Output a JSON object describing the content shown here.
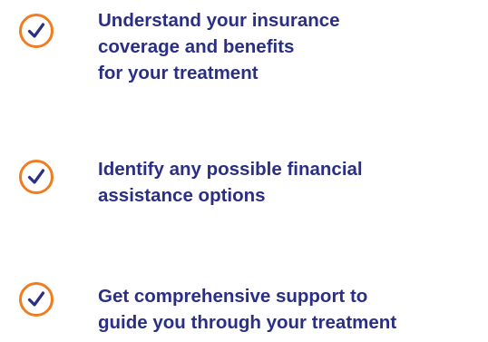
{
  "colors": {
    "accent": "#f07d1f",
    "text": "#2a2f85",
    "check": "#2a2f85"
  },
  "items": [
    {
      "icon": "check-circle-icon",
      "lines": [
        "Understand your insurance",
        "coverage and benefits",
        "for your treatment"
      ]
    },
    {
      "icon": "check-circle-icon",
      "lines": [
        "Identify any possible financial",
        "assistance options"
      ]
    },
    {
      "icon": "check-circle-icon",
      "lines": [
        "Get comprehensive support to",
        "guide you through your treatment"
      ]
    }
  ]
}
